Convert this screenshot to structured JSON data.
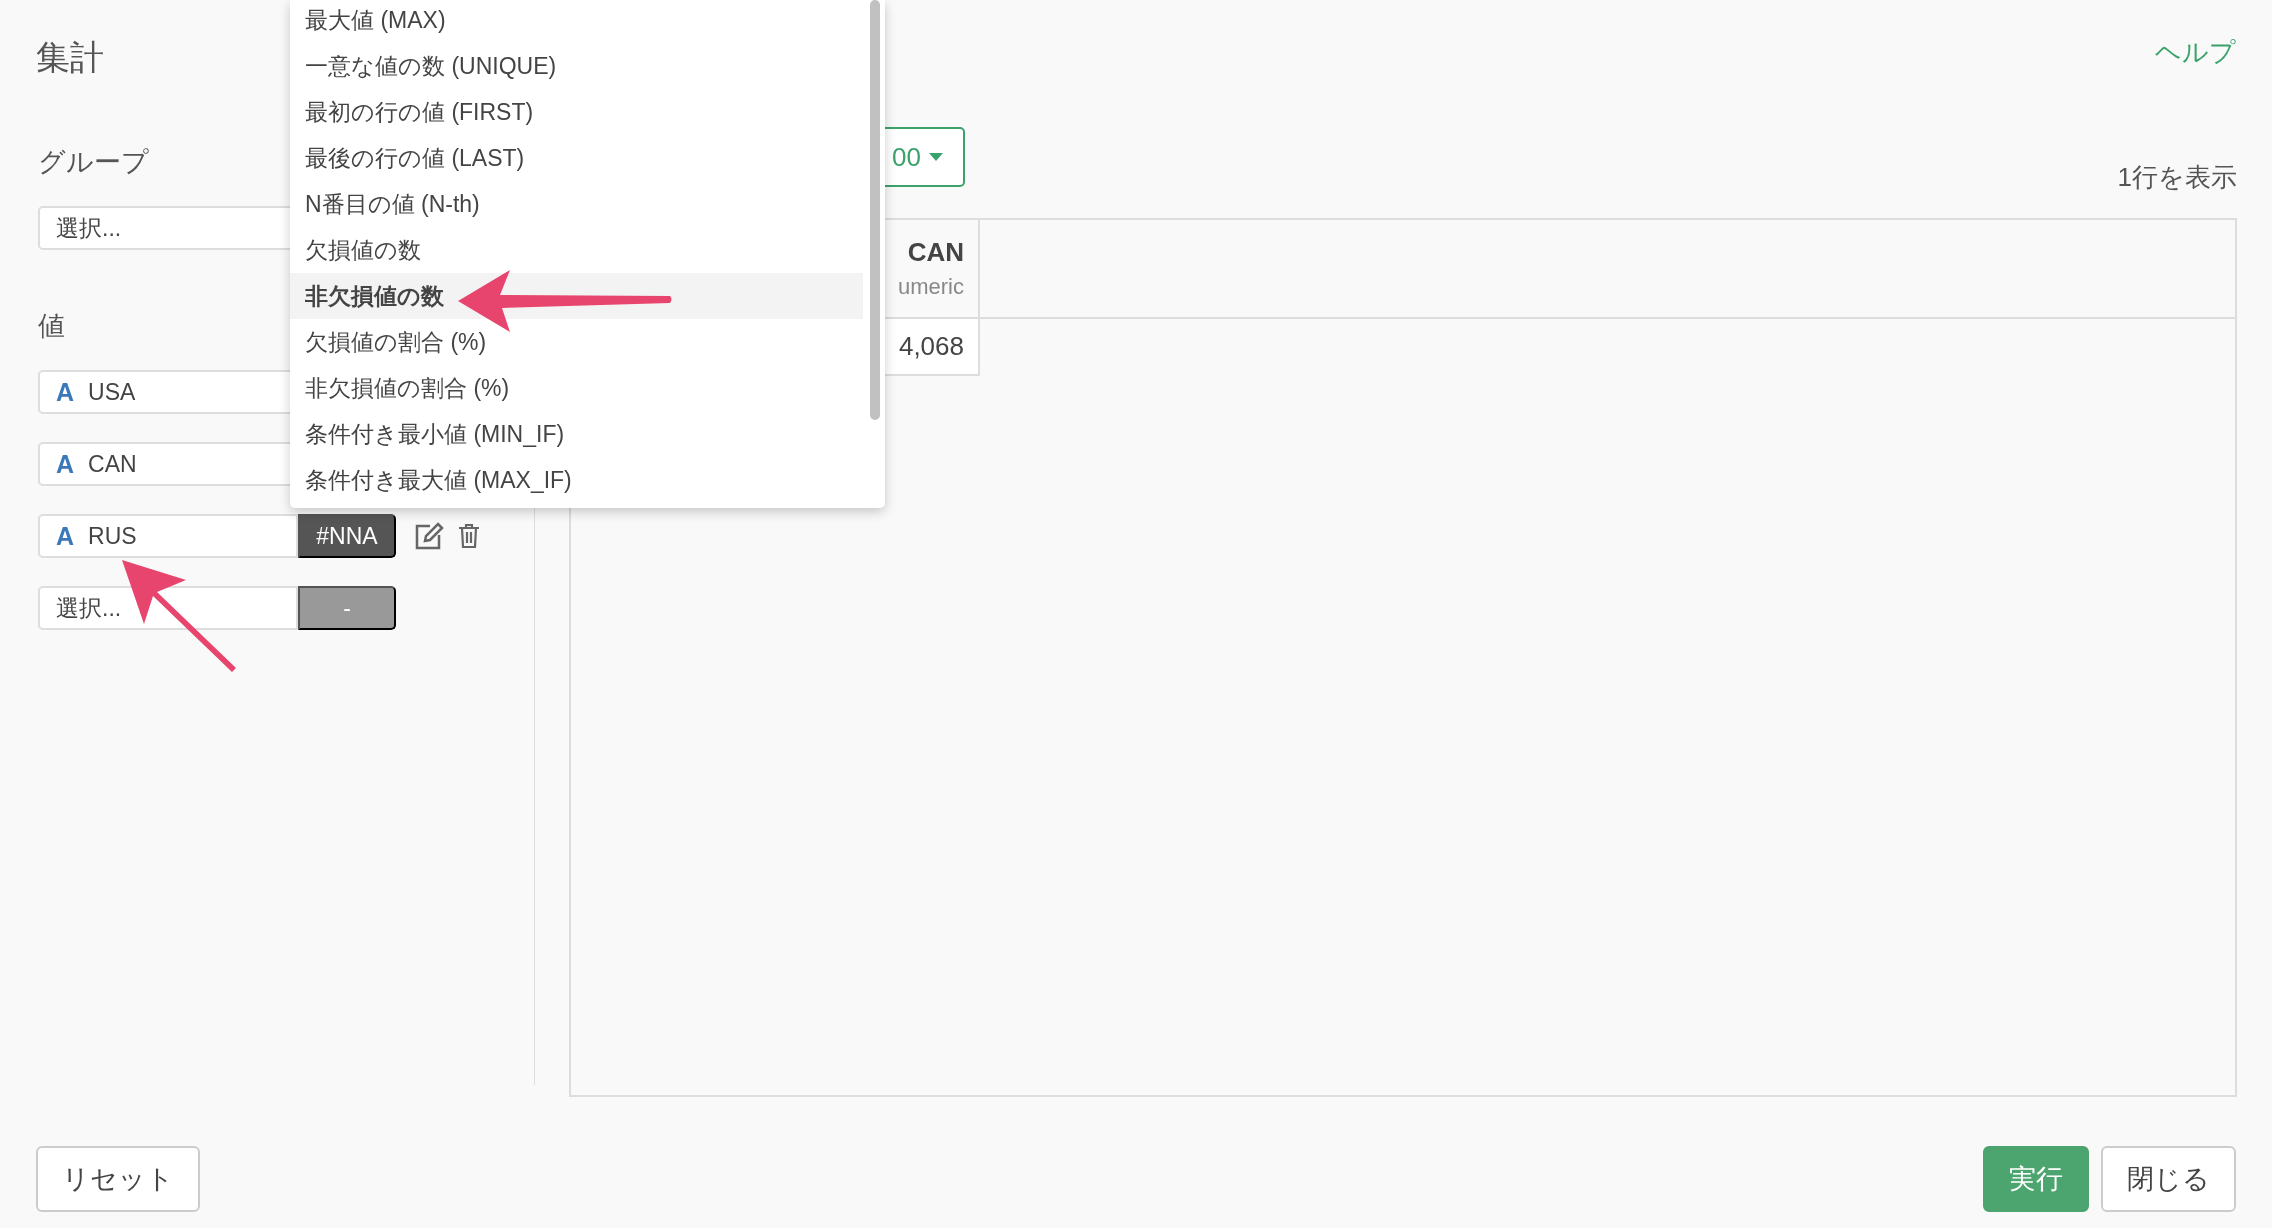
{
  "title": "集計",
  "help_link": "ヘルプ",
  "group": {
    "label": "グループ",
    "placeholder": "選択..."
  },
  "values": {
    "label": "値",
    "rows": [
      {
        "kind": "column",
        "type_icon": "A",
        "name": "USA"
      },
      {
        "kind": "column",
        "type_icon": "A",
        "name": "CAN"
      },
      {
        "kind": "column",
        "type_icon": "A",
        "name": "RUS",
        "aggregate": "#NNA"
      },
      {
        "kind": "empty",
        "placeholder": "選択...",
        "aggregate": "-"
      }
    ]
  },
  "menu": {
    "items": [
      {
        "label": "最大値 (MAX)",
        "selected": false
      },
      {
        "label": "一意な値の数 (UNIQUE)",
        "selected": false
      },
      {
        "label": "最初の行の値 (FIRST)",
        "selected": false
      },
      {
        "label": "最後の行の値 (LAST)",
        "selected": false
      },
      {
        "label": "N番目の値 (N-th)",
        "selected": false
      },
      {
        "label": "欠損値の数",
        "selected": false
      },
      {
        "label": "非欠損値の数",
        "selected": true
      },
      {
        "label": "欠損値の割合 (%)",
        "selected": false
      },
      {
        "label": "非欠損値の割合 (%)",
        "selected": false
      },
      {
        "label": "条件付き最小値 (MIN_IF)",
        "selected": false
      },
      {
        "label": "条件付き最大値 (MAX_IF)",
        "selected": false
      }
    ]
  },
  "preview": {
    "limit_button": "00",
    "row_count": "1行を表示",
    "columns": [
      {
        "name": "CAN",
        "type": "umeric"
      }
    ],
    "rows": [
      [
        "4,068"
      ]
    ]
  },
  "footer": {
    "reset": "リセット",
    "run": "実行",
    "close": "閉じる"
  }
}
